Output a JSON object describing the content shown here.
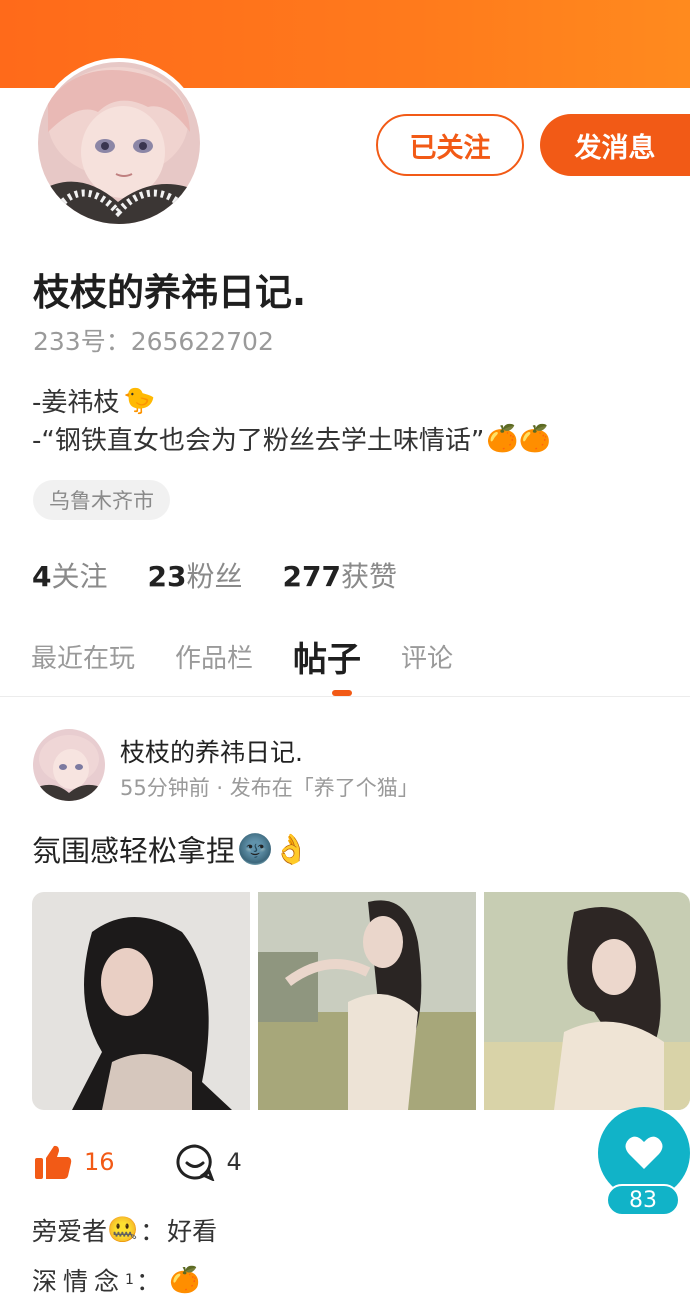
{
  "colors": {
    "accent": "#f25a16",
    "header": "#ff7a1c",
    "fab": "#11b3c8"
  },
  "profile": {
    "name": "枝枝的养祎日记.",
    "uid": "233号：265622702",
    "bio_line1": "-姜祎枝",
    "bio_line1_emoji": "🐤",
    "bio_line2": "-“钢铁直女也会为了粉丝去学土味情话”",
    "bio_line2_emoji": "🍊🍊",
    "location": "乌鲁木齐市"
  },
  "buttons": {
    "followed": "已关注",
    "message": "发消息"
  },
  "stats": [
    {
      "num": "4",
      "label": "关注"
    },
    {
      "num": "23",
      "label": "粉丝"
    },
    {
      "num": "277",
      "label": "获赞"
    }
  ],
  "tabs": [
    "最近在玩",
    "作品栏",
    "帖子",
    "评论"
  ],
  "active_tab": "帖子",
  "post": {
    "author": "枝枝的养祎日记.",
    "meta": "55分钟前 · 发布在「养了个猫」",
    "text": "氛围感轻松拿捏",
    "text_emoji": "🌚👌",
    "likes": "16",
    "comments": "4",
    "replies": [
      {
        "name": "旁爱者",
        "emoji": "🤐",
        "text": "好看"
      },
      {
        "name": "深情念",
        "sup": "1",
        "emoji": "🍊",
        "text": ""
      }
    ]
  },
  "fab": {
    "count": "83",
    "icon": "heart-icon"
  }
}
